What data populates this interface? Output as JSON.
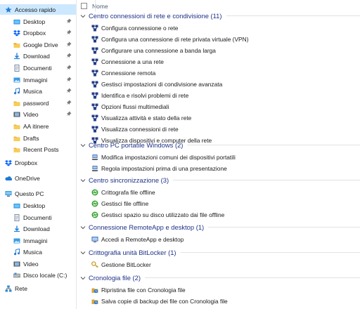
{
  "sidebar": {
    "items": [
      {
        "label": "Accesso rapido",
        "icon": "star-icon",
        "pinned": false,
        "selected": true,
        "indent": 0
      },
      {
        "label": "Desktop",
        "icon": "desktop-folder-icon",
        "pinned": true,
        "indent": 1
      },
      {
        "label": "Dropbox",
        "icon": "dropbox-folder-icon",
        "pinned": true,
        "indent": 1
      },
      {
        "label": "Google Drive",
        "icon": "google-drive-folder-icon",
        "pinned": true,
        "indent": 1
      },
      {
        "label": "Download",
        "icon": "download-folder-icon",
        "pinned": true,
        "indent": 1
      },
      {
        "label": "Documenti",
        "icon": "documents-folder-icon",
        "pinned": true,
        "indent": 1
      },
      {
        "label": "Immagini",
        "icon": "pictures-folder-icon",
        "pinned": true,
        "indent": 1
      },
      {
        "label": "Musica",
        "icon": "music-folder-icon",
        "pinned": true,
        "indent": 1
      },
      {
        "label": "password",
        "icon": "folder-icon",
        "pinned": true,
        "indent": 1
      },
      {
        "label": "Video",
        "icon": "video-folder-icon",
        "pinned": true,
        "indent": 1
      },
      {
        "label": "AA itinere",
        "icon": "folder-icon",
        "pinned": false,
        "indent": 1
      },
      {
        "label": "Drafts",
        "icon": "folder-icon",
        "pinned": false,
        "indent": 1
      },
      {
        "label": "Recent Posts",
        "icon": "folder-icon",
        "pinned": false,
        "indent": 1
      },
      {
        "label": "Dropbox",
        "icon": "dropbox-icon",
        "pinned": false,
        "indent": 0
      },
      {
        "label": "OneDrive",
        "icon": "onedrive-icon",
        "pinned": false,
        "indent": 0
      },
      {
        "label": "Questo PC",
        "icon": "computer-icon",
        "pinned": false,
        "indent": 0
      },
      {
        "label": "Desktop",
        "icon": "desktop-folder-icon",
        "pinned": false,
        "indent": 1
      },
      {
        "label": "Documenti",
        "icon": "documents-folder-icon",
        "pinned": false,
        "indent": 1
      },
      {
        "label": "Download",
        "icon": "download-folder-icon",
        "pinned": false,
        "indent": 1
      },
      {
        "label": "Immagini",
        "icon": "pictures-folder-icon",
        "pinned": false,
        "indent": 1
      },
      {
        "label": "Musica",
        "icon": "music-folder-icon",
        "pinned": false,
        "indent": 1
      },
      {
        "label": "Video",
        "icon": "video-folder-icon",
        "pinned": false,
        "indent": 1
      },
      {
        "label": "Disco locale (C:)",
        "icon": "drive-icon",
        "pinned": false,
        "indent": 1
      },
      {
        "label": "Rete",
        "icon": "network-icon",
        "pinned": false,
        "indent": 0
      }
    ]
  },
  "header": {
    "name_col": "Nome"
  },
  "groups": [
    {
      "title": "Centro connessioni di rete e condivisione (11)",
      "icon": "network-center-icon",
      "items": [
        "Configura connessione o rete",
        "Configura una connessione di rete privata virtuale (VPN)",
        "Configurare una connessione a banda larga",
        "Connessione a una rete",
        "Connessione remota",
        "Gestisci impostazioni di condivisione avanzata",
        "Identifica e risolvi problemi di rete",
        "Opzioni flussi multimediali",
        "Visualizza attività e stato della rete",
        "Visualizza connessioni di rete",
        "Visualizza dispositivi e computer della rete"
      ]
    },
    {
      "title": "Centro PC portatile Windows (2)",
      "icon": "mobility-center-icon",
      "items": [
        "Modifica impostazioni comuni dei dispositivi portatili",
        "Regola impostazioni prima di una presentazione"
      ]
    },
    {
      "title": "Centro sincronizzazione (3)",
      "icon": "sync-center-icon",
      "items": [
        "Crittografa file offline",
        "Gestisci file offline",
        "Gestisci spazio su disco utilizzato dai file offline"
      ]
    },
    {
      "title": "Connessione RemoteApp e desktop (1)",
      "icon": "remoteapp-icon",
      "items": [
        "Accedi a RemoteApp e desktop"
      ]
    },
    {
      "title": "Crittografia unità BitLocker (1)",
      "icon": "bitlocker-icon",
      "items": [
        "Gestione BitLocker"
      ]
    },
    {
      "title": "Cronologia file (2)",
      "icon": "file-history-icon",
      "items": [
        "Ripristina file con Cronologia file",
        "Salva copie di backup dei file con Cronologia file"
      ]
    }
  ],
  "colors": {
    "selected": "#cce8ff",
    "group_title": "#1e3287",
    "folder": "#e8b53b"
  }
}
